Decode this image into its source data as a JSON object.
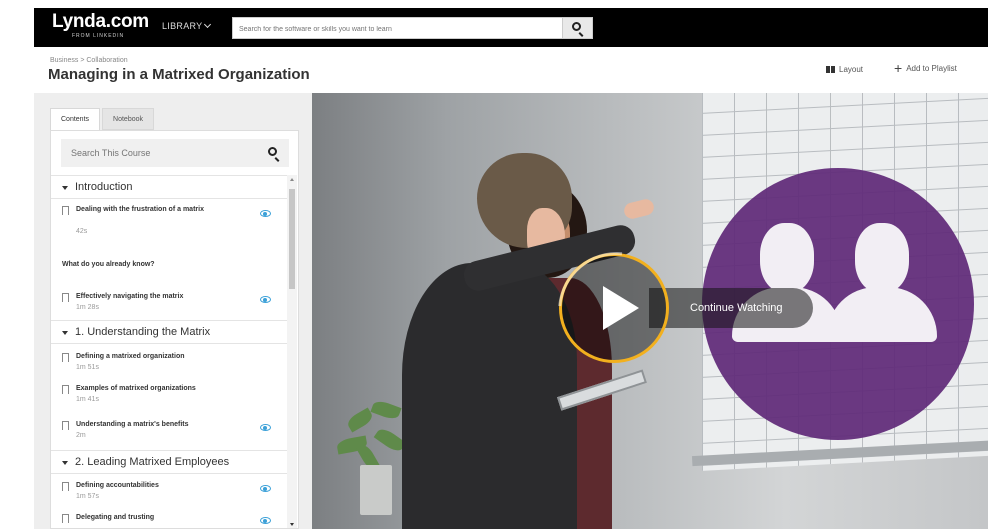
{
  "topbar": {
    "logo": "Lynda.com",
    "logo_sub": "FROM LINKEDIN",
    "library_label": "LIBRARY",
    "search_placeholder": "Search for the software or skills you want to learn"
  },
  "header": {
    "breadcrumb": "Business  >  Collaboration",
    "title": "Managing in a Matrixed Organization",
    "layout_label": "Layout",
    "add_to_playlist_label": "Add to Playlist"
  },
  "sidebar": {
    "tabs": [
      {
        "label": "Contents"
      },
      {
        "label": "Notebook"
      }
    ],
    "search_placeholder": "Search This Course",
    "chapters": [
      {
        "title": "Introduction"
      },
      {
        "title": "1. Understanding the Matrix"
      },
      {
        "title": "2. Leading Matrixed Employees"
      }
    ],
    "videos": [
      {
        "title": "Dealing with the frustration of a matrix",
        "duration": "42s"
      },
      {
        "title": "Effectively navigating the matrix",
        "duration": "1m 28s"
      },
      {
        "title": "Defining a matrixed organization",
        "duration": "1m 51s"
      },
      {
        "title": "Examples of matrixed organizations",
        "duration": "1m 41s"
      },
      {
        "title": "Understanding a matrix's benefits",
        "duration": "2m"
      },
      {
        "title": "Defining accountabilities",
        "duration": "1m 57s"
      },
      {
        "title": "Delegating and trusting",
        "duration": ""
      }
    ],
    "quiz_label": "What do you already know?"
  },
  "player": {
    "continue_label": "Continue Watching",
    "accent_color": "#f2b01e",
    "overlay_color": "#602a78"
  },
  "icons": {
    "search": "search-icon",
    "eye": "watched-eye-icon",
    "bookmark": "bookmark-icon",
    "play": "play-icon",
    "people": "people-icon"
  }
}
